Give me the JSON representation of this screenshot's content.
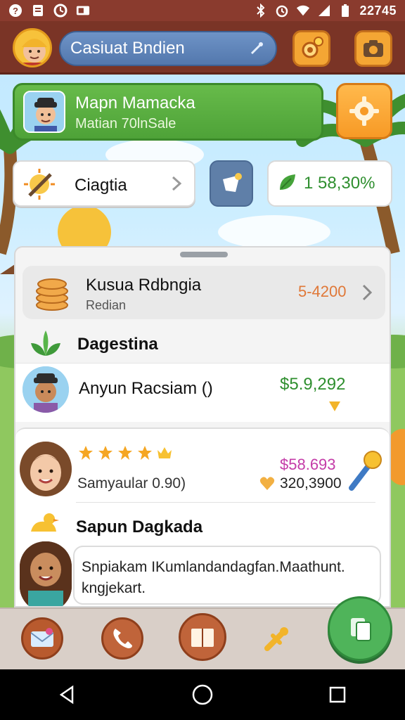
{
  "status_bar": {
    "time": "22745"
  },
  "app_bar": {
    "title": "Casiuat Bndien"
  },
  "profile": {
    "name": "Mapn Mamacka",
    "subtitle": "Matian 70lnSale"
  },
  "quick_row": {
    "label": "Ciagtia",
    "balance": "1 58,30%"
  },
  "list": {
    "row1": {
      "title": "Kusua Rdbngia",
      "subtitle": "Redian",
      "value": "5-4200"
    },
    "section_title": "Dagestina",
    "row2": {
      "name": "Anyun Racsiam ()",
      "value": "$5.9,292"
    }
  },
  "card3": {
    "rating_text": "Samyaular 0.90)",
    "price_pink": "$58.693",
    "price_dark": "320,3900",
    "title": "Sapun Dagkada",
    "description": "Snpiakam IKumlandandagfan.Maathunt. kngjekart."
  },
  "colors": {
    "app_bar": "#7a3426",
    "accent_green": "#4ea238",
    "accent_orange": "#f79a26",
    "price_green": "#2f8f2f",
    "price_orange": "#e07838",
    "price_pink": "#c43ca8"
  },
  "icons": {
    "status": [
      "question-icon",
      "note-icon",
      "clock-icon",
      "media-icon",
      "bluetooth-icon",
      "alarm-icon",
      "wifi-icon",
      "signal-icon",
      "battery-icon"
    ],
    "dock": [
      "mail-icon",
      "phone-icon",
      "book-icon",
      "tool-icon",
      "copy-icon"
    ],
    "nav": [
      "back-icon",
      "home-icon",
      "recents-icon"
    ]
  }
}
